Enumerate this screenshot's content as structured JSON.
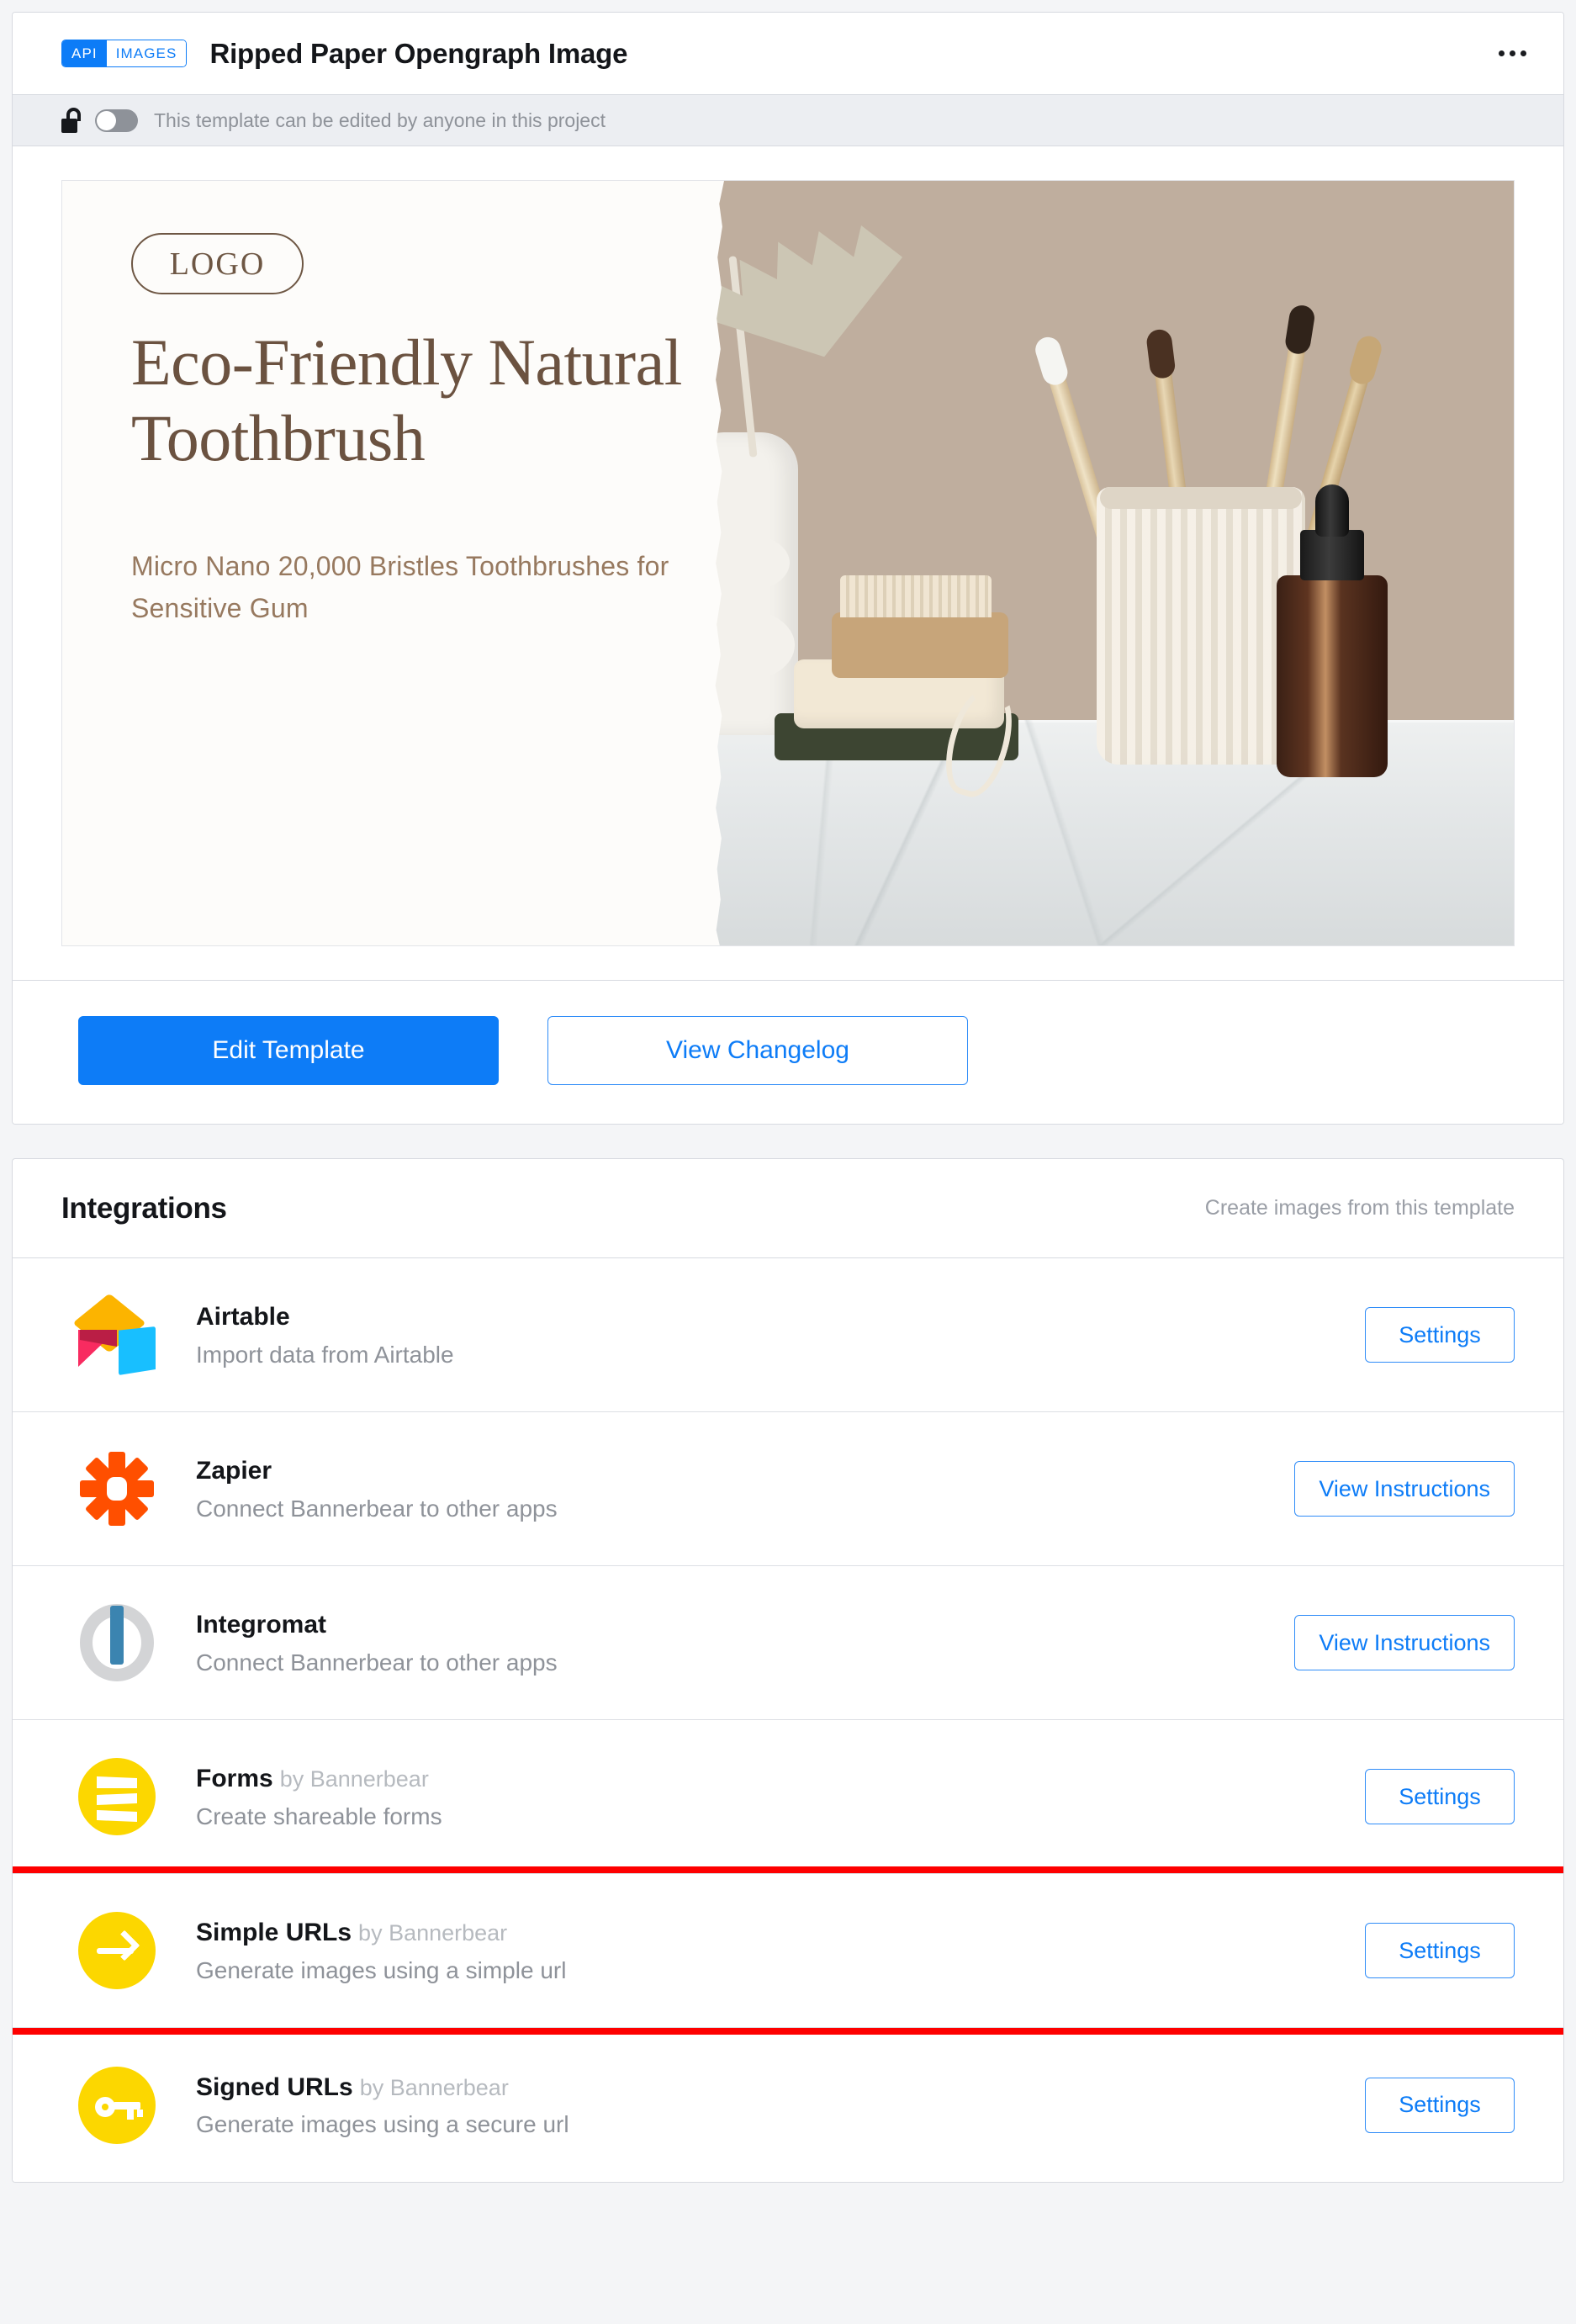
{
  "header": {
    "badge_api": "API",
    "badge_images": "IMAGES",
    "title": "Ripped Paper Opengraph Image",
    "overflow_menu": "more-options"
  },
  "permission_bar": {
    "lock_icon": "unlocked-padlock-icon",
    "toggle_state": "off",
    "text": "This template can be edited by anyone in this project"
  },
  "template_preview": {
    "logo_label": "LOGO",
    "headline": "Eco-Friendly Natural Toothbrush",
    "subtext": "Micro  Nano 20,000 Bristles Toothbrushes for Sensitive Gum",
    "photo_alt": "bamboo toothbrushes in a ribbed ceramic cup on a marble counter with soap, nail brush and amber dropper bottle",
    "colors": {
      "headline": "#6b5240",
      "subtext": "#97795f",
      "paper": "#fdfcfa",
      "wall": "#bfae9e"
    }
  },
  "actions": {
    "edit_template": "Edit Template",
    "view_changelog": "View Changelog"
  },
  "integrations": {
    "title": "Integrations",
    "note": "Create images from this template",
    "rows": [
      {
        "icon": "airtable-logo-icon",
        "name": "Airtable",
        "by": "",
        "description": "Import data from Airtable",
        "action": "Settings",
        "highlighted": false
      },
      {
        "icon": "zapier-logo-icon",
        "name": "Zapier",
        "by": "",
        "description": "Connect Bannerbear to other apps",
        "action": "View Instructions",
        "highlighted": false
      },
      {
        "icon": "integromat-logo-icon",
        "name": "Integromat",
        "by": "",
        "description": "Connect Bannerbear to other apps",
        "action": "View Instructions",
        "highlighted": false
      },
      {
        "icon": "forms-logo-icon",
        "name": "Forms",
        "by": "by Bannerbear",
        "description": "Create shareable forms",
        "action": "Settings",
        "highlighted": false
      },
      {
        "icon": "simple-urls-arrow-icon",
        "name": "Simple URLs",
        "by": "by Bannerbear",
        "description": "Generate images using a simple url",
        "action": "Settings",
        "highlighted": true
      },
      {
        "icon": "signed-urls-key-icon",
        "name": "Signed URLs",
        "by": "by Bannerbear",
        "description": "Generate images using a secure url",
        "action": "Settings",
        "highlighted": false
      }
    ]
  },
  "colors": {
    "accent_blue": "#0d7cf7",
    "page_background": "#f4f5f7",
    "card_border": "#d7dae0",
    "muted_text": "#8e9299",
    "highlight_red": "#fe0000",
    "brand_yellow": "#fcd700"
  }
}
